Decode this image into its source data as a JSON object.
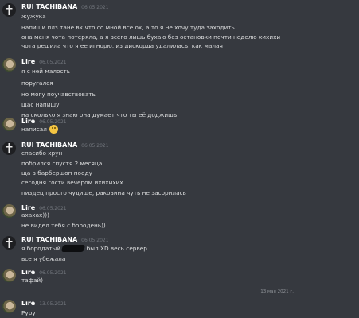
{
  "messages": [
    {
      "author": "RUI TACHIBANA",
      "timestamp": "06.05.2021",
      "avatar": "rui-avatar",
      "lines": [
        "жужука",
        "напиши плз тане вк что со мной все ок, а то я не хочу туда заходить",
        "она меня чота потеряла, а я всего лишь бухаю без остановки почти неделю хихихи",
        "чота решила что я ее игнорю, из дискорда удалилась, как малая"
      ]
    },
    {
      "author": "Lire",
      "timestamp": "06.05.2021",
      "avatar": "lire-avatar",
      "lines": [
        "я с ней малость",
        "поругался",
        "но могу поучавствовать",
        "щас напишу",
        "на сколько я знаю она думает что ты её доджишь"
      ]
    },
    {
      "author": "Lire",
      "timestamp": "06.05.2021",
      "avatar": "lire-avatar",
      "lines": [
        "написал"
      ],
      "emoji": "slightly-smiling-face-emoji"
    },
    {
      "author": "RUI TACHIBANA",
      "timestamp": "06.05.2021",
      "avatar": "rui-avatar",
      "lines": [
        "спасибо хрун",
        "побрился спустя 2 месяца",
        "ща в барбершоп поеду",
        "сегодня гости вечером ихихихих",
        "пиздец просто чудище, раковина чуть не засорилась"
      ]
    },
    {
      "author": "Lire",
      "timestamp": "06.05.2021",
      "avatar": "lire-avatar",
      "lines": [
        "ахахах)))",
        "не видел тебя с бородень))"
      ]
    },
    {
      "author": "RUI TACHIBANA",
      "timestamp": "06.05.2021",
      "avatar": "rui-avatar",
      "lines": [
        "я бородатый",
        "был XD весь сервер",
        "все я убежала"
      ]
    },
    {
      "author": "Lire",
      "timestamp": "06.05.2021",
      "avatar": "lire-avatar",
      "lines": [
        "тафай)"
      ]
    },
    {
      "author": "Lire",
      "timestamp": "13.05.2021",
      "avatar": "lire-avatar",
      "lines": [
        "Руру"
      ]
    }
  ],
  "divider": {
    "date": "13 мая 2021 г."
  }
}
